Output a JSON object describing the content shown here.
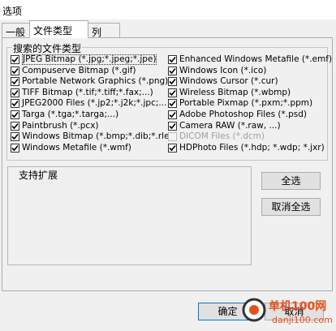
{
  "window": {
    "title": "选项"
  },
  "tabs": [
    {
      "label": "一般"
    },
    {
      "label": "文件类型"
    },
    {
      "label": "列"
    }
  ],
  "filetypes": {
    "group_label": "搜索的文件类型",
    "left": [
      {
        "label": "JPEG Bitmap (*.jpg;*.jpeg;*.jpe)",
        "checked": true
      },
      {
        "label": "Compuserve Bitmap (*.gif)",
        "checked": true
      },
      {
        "label": "Portable Network Graphics (*.png)",
        "checked": true
      },
      {
        "label": "TIFF Bitmap (*.tif;*.tiff;*.fax;...)",
        "checked": true
      },
      {
        "label": "JPEG2000 Files (*.jp2;*.j2k;*.jpc;...",
        "checked": true
      },
      {
        "label": "Targa (*.tga;*.targa;...)",
        "checked": true
      },
      {
        "label": "Paintbrush (*.pcx)",
        "checked": true
      },
      {
        "label": "Windows Bitmap (*.bmp;*.dib;*.rle)",
        "checked": true
      },
      {
        "label": "Windows Metafile (*.wmf)",
        "checked": true
      }
    ],
    "right": [
      {
        "label": "Enhanced Windows Metafile (*.emf)",
        "checked": true
      },
      {
        "label": "Windows Icon (*.ico)",
        "checked": true
      },
      {
        "label": "Windows Cursor (*.cur)",
        "checked": true
      },
      {
        "label": "Wireless Bitmap (*.wbmp)",
        "checked": true
      },
      {
        "label": "Portable Pixmap (*.pxm;*.ppm)",
        "checked": true
      },
      {
        "label": "Adobe Photoshop Files (*.psd)",
        "checked": true
      },
      {
        "label": "Camera RAW (*.raw, ...)",
        "checked": true
      },
      {
        "label": "DICOM Files (*.dcm)",
        "checked": false,
        "disabled": true
      },
      {
        "label": "HDPhoto Files (*.hdp; *.wdp; *.jxr)",
        "checked": true
      }
    ]
  },
  "extensions": {
    "label": "支持扩展"
  },
  "buttons": {
    "select_all": "全选",
    "deselect_all": "取消全选",
    "ok": "确定",
    "cancel": "取消"
  },
  "watermark": {
    "text": "单机100网",
    "url": "danji100.com"
  }
}
